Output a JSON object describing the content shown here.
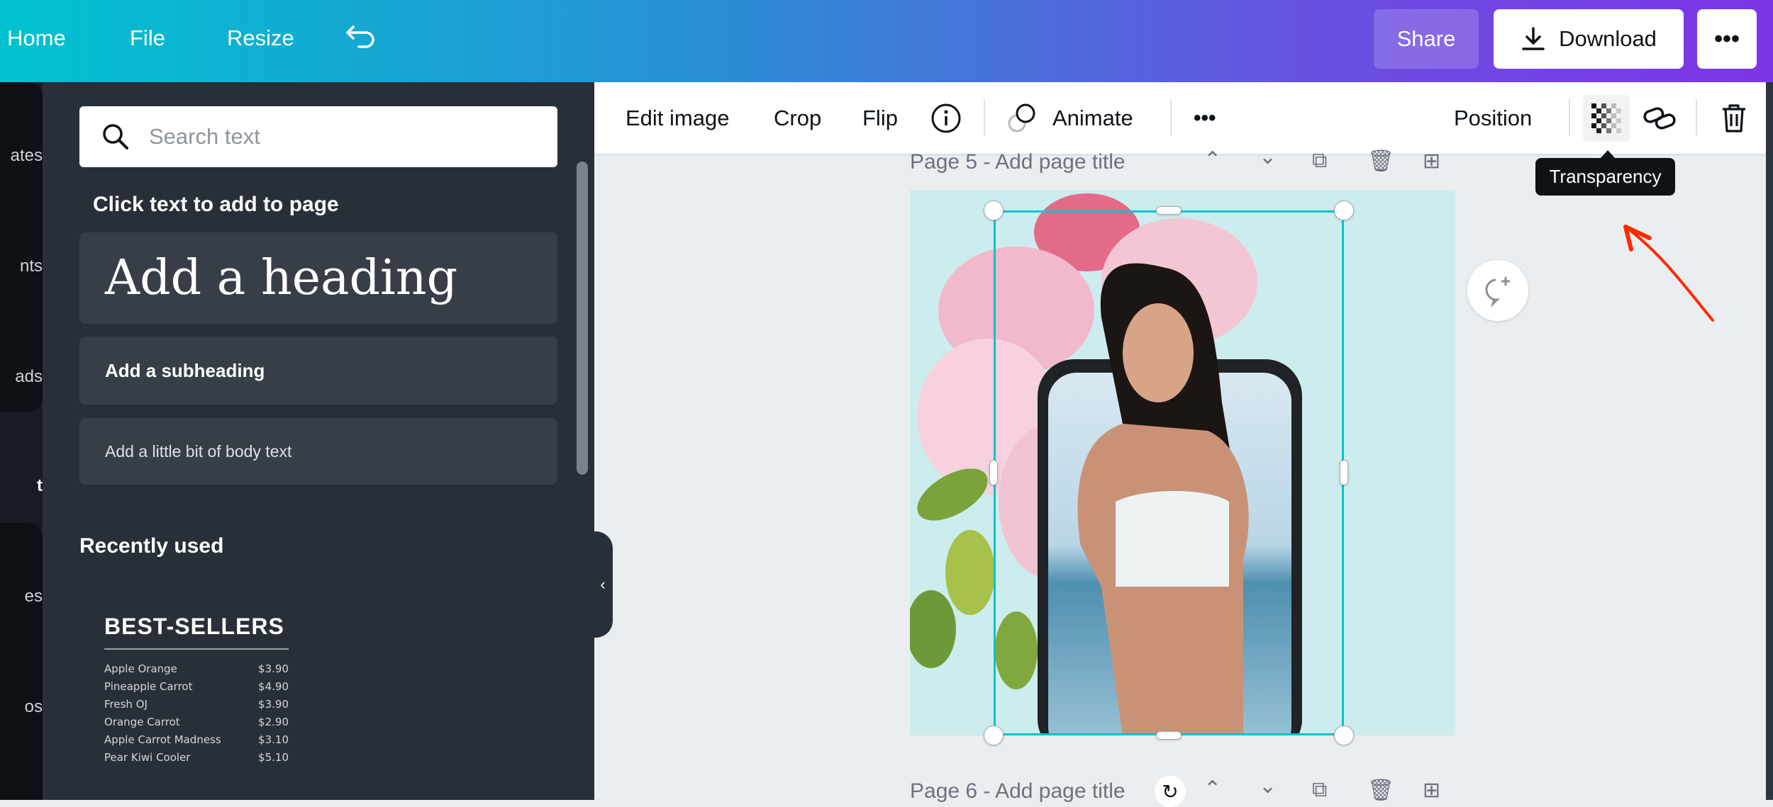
{
  "topbar": {
    "home": "Home",
    "file": "File",
    "resize": "Resize",
    "undo_icon": "undo-icon",
    "share": "Share",
    "download": "Download",
    "more_icon": "more-icon"
  },
  "rail": {
    "items": [
      "ates",
      "nts",
      "ads",
      "t",
      "es",
      "os"
    ]
  },
  "panel": {
    "search_placeholder": "Search text",
    "section_title": "Click text to add to page",
    "heading": "Add a heading",
    "subheading": "Add a subheading",
    "body": "Add a little bit of body text",
    "recent_title": "Recently used",
    "recent_template": {
      "title": "BEST-SELLERS",
      "rows": [
        {
          "name": "Apple Orange",
          "price": "$3.90"
        },
        {
          "name": "Pineapple Carrot",
          "price": "$4.90"
        },
        {
          "name": "Fresh OJ",
          "price": "$3.90"
        },
        {
          "name": "Orange Carrot",
          "price": "$2.90"
        },
        {
          "name": "Apple Carrot Madness",
          "price": "$3.10"
        },
        {
          "name": "Pear Kiwi Cooler",
          "price": "$5.10"
        }
      ]
    }
  },
  "toolbar": {
    "edit_image": "Edit image",
    "crop": "Crop",
    "flip": "Flip",
    "animate": "Animate",
    "position": "Position",
    "tooltip": "Transparency"
  },
  "canvas": {
    "page5_title": "Page 5 - Add page title",
    "page6_title": "Page 6 - Add page title"
  },
  "colors": {
    "accent": "#00c4cc",
    "selection": "#00c4cc",
    "annotation_arrow": "#ff2a00",
    "page_bg": "#cdeced"
  }
}
